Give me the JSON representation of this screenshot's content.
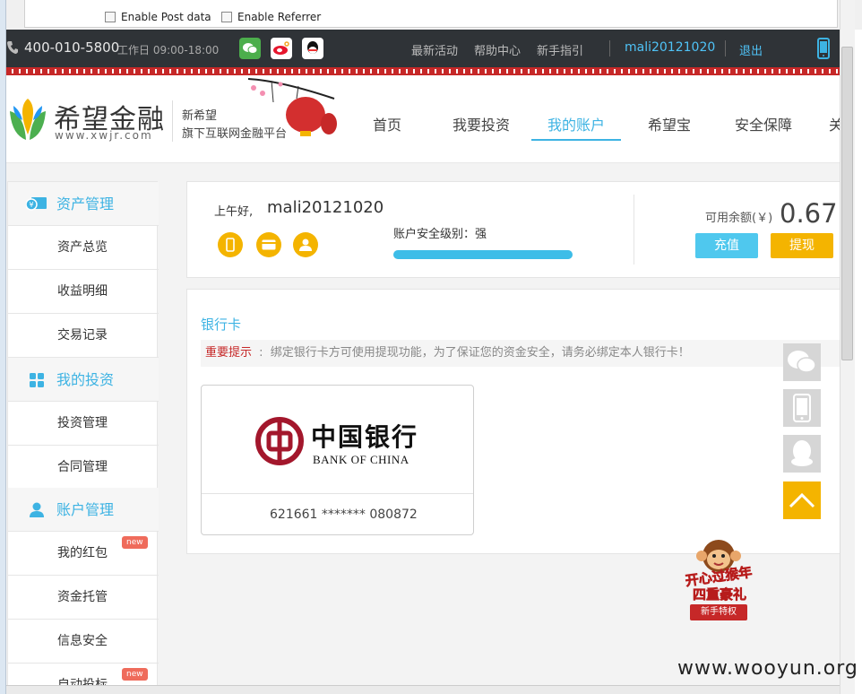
{
  "browser": {
    "enable_post": "Enable Post data",
    "enable_referrer": "Enable Referrer"
  },
  "topbar": {
    "phone": "400-010-5800",
    "work_hours": "工作日 09:00-18:00",
    "links": [
      "最新活动",
      "帮助中心",
      "新手指引"
    ],
    "username": "mali20121020",
    "logout": "退出"
  },
  "logo": {
    "cn": "希望金融",
    "url": "www.xwjr.com",
    "tag1": "新希望",
    "tag2": "旗下互联网金融平台"
  },
  "nav": [
    "首页",
    "我要投资",
    "我的账户",
    "希望宝",
    "安全保障",
    "关"
  ],
  "sidebar": {
    "asset_head": "资产管理",
    "asset_items": [
      "资产总览",
      "收益明细",
      "交易记录"
    ],
    "invest_head": "我的投资",
    "invest_items": [
      "投资管理",
      "合同管理"
    ],
    "account_head": "账户管理",
    "account_items": [
      "我的红包",
      "资金托管",
      "信息安全",
      "自动投标"
    ],
    "new_badge": "new"
  },
  "summary": {
    "greeting": "上午好,",
    "username": "mali20121020",
    "security_label": "账户安全级别：强",
    "security_level": 1.0,
    "balance_label": "可用余额(￥)",
    "balance": "0.67",
    "recharge": "充值",
    "withdraw": "提现"
  },
  "bankcard": {
    "title": "银行卡",
    "notice_label": "重要提示",
    "notice_sep": ":",
    "notice_text": "绑定银行卡方可使用提现功能，为了保证您的资金安全，请务必绑定本人银行卡！",
    "bank_cn": "中国银行",
    "bank_en": "BANK OF CHINA",
    "card_number": "621661 ******* 080872"
  },
  "promo": {
    "l1": "开心过猴年",
    "l2": "四重豪礼",
    "l3": "新手特权"
  },
  "watermark": "www.wooyun.org",
  "colors": {
    "accent": "#3db3e3",
    "orange": "#f4b400",
    "dark": "#2f3337",
    "red": "#c62828"
  }
}
